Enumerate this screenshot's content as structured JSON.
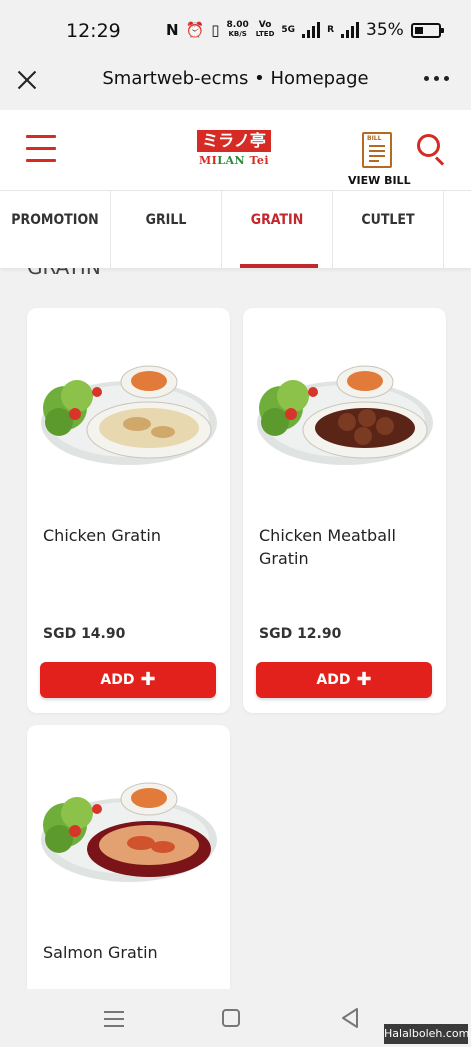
{
  "status_bar": {
    "time": "12:29",
    "nfc": "N",
    "speed_value": "8.00",
    "speed_unit": "KB/S",
    "volte_top": "Vo",
    "volte_bottom": "LTED",
    "network": "5G",
    "roaming": "R",
    "battery_percent": "35%",
    "battery_level": 0.35
  },
  "browser": {
    "title": "Smartweb-ecms • Homepage"
  },
  "header": {
    "logo_top": "ミラノ亭",
    "logo_bottom_a": "MI",
    "logo_bottom_b": "LAN",
    "logo_bottom_c": " Tei",
    "bill_icon_text": "BILL",
    "view_bill_label": "VIEW BILL",
    "accent_color": "#d62b24"
  },
  "tabs": [
    {
      "label": "PROMOTION",
      "active": false
    },
    {
      "label": "GRILL",
      "active": false
    },
    {
      "label": "GRATIN",
      "active": true
    },
    {
      "label": "CUTLET",
      "active": false
    }
  ],
  "section": {
    "heading": "GRATIN"
  },
  "products": [
    {
      "name": "Chicken Gratin",
      "price": "SGD 14.90",
      "button": "ADD",
      "dish": "chicken-gratin"
    },
    {
      "name": "Chicken Meatball Gratin",
      "price": "SGD 12.90",
      "button": "ADD",
      "dish": "meatball-gratin"
    },
    {
      "name": "Salmon Gratin",
      "price": "",
      "button": "",
      "dish": "salmon-gratin"
    }
  ],
  "watermark": "Halalboleh.com"
}
